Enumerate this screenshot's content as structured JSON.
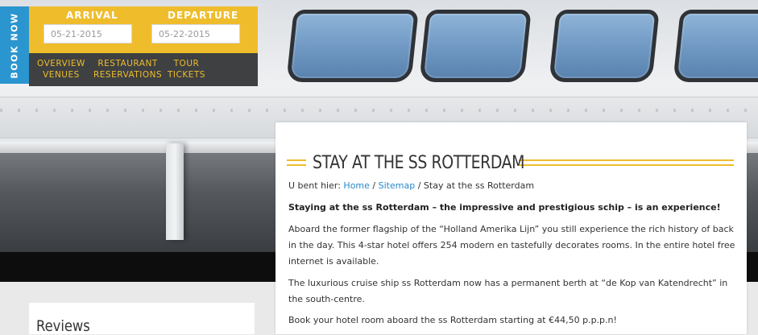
{
  "booking": {
    "book_now": "BOOK NOW",
    "arrival_label": "ARRIVAL",
    "departure_label": "DEPARTURE",
    "arrival_value": "05-21-2015",
    "departure_value": "05-22-2015"
  },
  "nav": [
    {
      "line1": "OVERVIEW",
      "line2": "VENUES"
    },
    {
      "line1": "RESTAURANT",
      "line2": "RESERVATIONS"
    },
    {
      "line1": "TOUR",
      "line2": "TICKETS"
    }
  ],
  "content": {
    "title": "STAY AT THE SS ROTTERDAM",
    "breadcrumb": {
      "prefix": "U bent hier:",
      "home": "Home",
      "sitemap": "Sitemap",
      "current": "Stay at the ss Rotterdam",
      "separator": "/"
    },
    "intro": "Staying at the ss Rotterdam – the impressive and prestigious schip – is an experience!",
    "paragraphs": [
      "Aboard the former flagship of the “Holland Amerika Lijn” you still experience the rich history of back in the day. This 4-star hotel offers 254 modern en tastefully decorates rooms. In the entire hotel free internet is available.",
      "The luxurious cruise ship ss Rotterdam now has a permanent berth at “de Kop van Katendrecht” in the south-centre.",
      "Book your hotel room aboard the ss Rotterdam starting at €44,50 p.p.p.n!"
    ]
  },
  "reviews": {
    "title": "Reviews"
  },
  "colors": {
    "accent": "#efbd2c",
    "book_now": "#2b95cf",
    "nav_bg": "#3e4042",
    "link": "#2b88c8"
  }
}
